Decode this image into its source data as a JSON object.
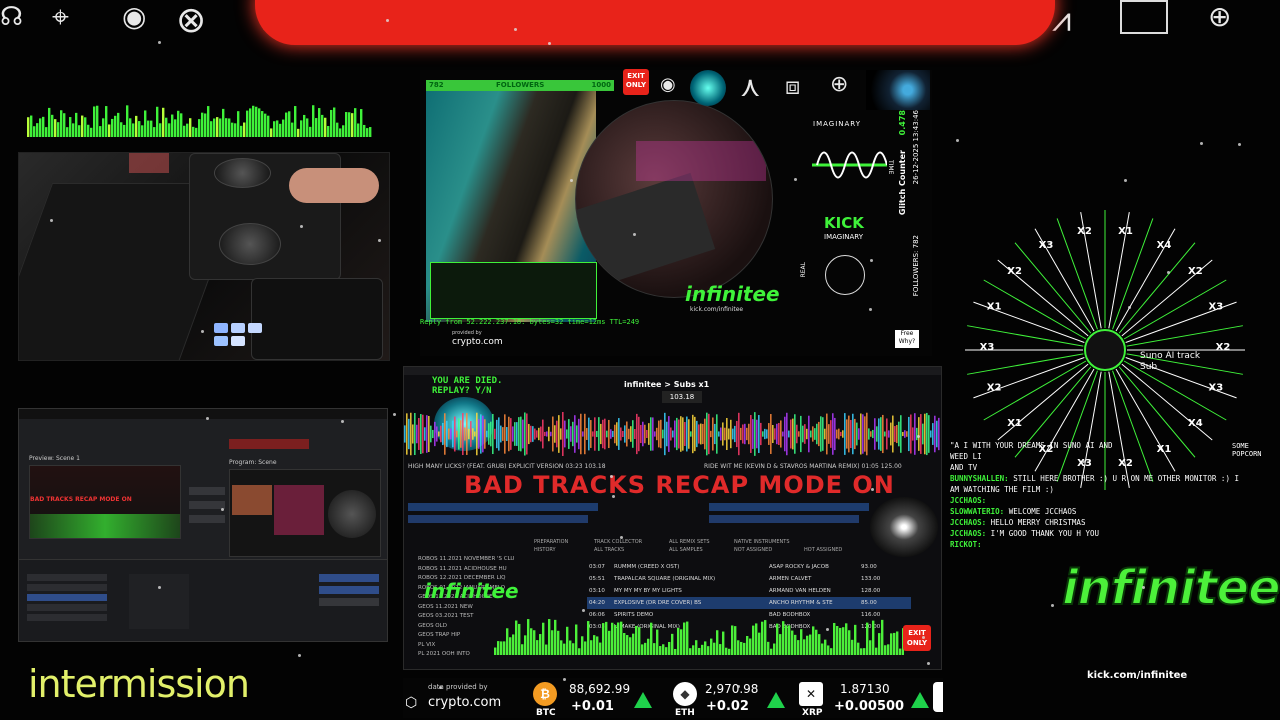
{
  "top_bar": {
    "glyphs": [
      "☊",
      "⌖",
      "◉",
      "⊗",
      "⋏",
      "⩘",
      "⊕"
    ]
  },
  "center_top": {
    "followers_label": "FOLLOWERS",
    "followers_left": "782",
    "followers_right": "1000",
    "exit_only": "EXIT ONLY",
    "imaginary": "IMAGINARY",
    "time": "TIME",
    "kick": "KICK",
    "kick_sub": "IMAGINARY",
    "real": "REAL",
    "glitch_counter": "Glitch Counter",
    "glitch_value": "0.478",
    "datetime": "26-12-2025 13:43:46",
    "followers_vertical": "FOLLOWERS: 782",
    "term_reply": "Reply from 52.222.237.18: bytes=32 time=12ms TTL=249",
    "provided_by": "provided by",
    "crypto_small": "crypto.com",
    "infinitee_small": "infinitee",
    "kick_url_small": "kick.com/infinitee",
    "free_why": "Free Why?"
  },
  "mixer": {
    "you_are_died": "YOU ARE DIED.",
    "replay": "REPLAY? Y/N",
    "app_title": "infinitee > Subs x1",
    "bpm": "103.18",
    "recap": "BAD TRACKS RECAP MODE ON",
    "tabs": [
      "PREPARATION",
      "HISTORY",
      "TRACK COLLECTOR",
      "ALL TRACKS",
      "ALL REMIX SETS",
      "ALL SAMPLES",
      "NATIVE INSTRUMENTS",
      "NOT ASSIGNED",
      "HOT ASSIGNED"
    ],
    "tracks": [
      {
        "time": "03:07",
        "title": "RUMMM (CREED X OST)",
        "artist": "ASAP ROCKY & JACOB",
        "bpm": "93.00"
      },
      {
        "time": "05:51",
        "title": "TRAPALCAR SQUARE (ORIGINAL MIX)",
        "artist": "ARMEN CALVET",
        "bpm": "133.00"
      },
      {
        "time": "03:10",
        "title": "MY MY MY BY MY LIGHTS",
        "artist": "ARMAND VAN HELDEN",
        "bpm": "128.00"
      },
      {
        "time": "04:20",
        "title": "EXPLOSIVE (DR DRE COVER) BS",
        "artist": "ANCHO RHYTHM & STE",
        "bpm": "85.00"
      },
      {
        "time": "06:06",
        "title": "SPIRITS DEMO",
        "artist": "BAD BODHBOX",
        "bpm": "116.00"
      },
      {
        "time": "03:03",
        "title": "U MAKE (ORIGINAL MIX)",
        "artist": "BAD BODHBOX",
        "bpm": "120.00"
      }
    ],
    "folders": [
      "ROBOS 11.2021 NOVEMBER 'S CLU",
      "ROBOS 11.2021 ACIDHOUSE HU",
      "ROBOS 12.2021 DECEMBER LIQ",
      "ROBOS 01.2022 JANUARY MELO",
      "GEOS 11.2021 ACIDHOUSE",
      "GEOS 11.2021 NEW",
      "GEOS 03.2021 TEST",
      "GEOS OLD",
      "GEOS TRAP HIP",
      "PL VIX",
      "PL 2021 OOH INTO"
    ],
    "exit_only": "EXIT ONLY",
    "deck_a_info": "HIGH MANY LICKS? (FEAT. GRUB) EXPLICIT VERSION 03:23 103.18",
    "deck_b_info": "RIDE WIT ME (KEVIN D & STAVROS MARTINA REMIX) 01:05 125.00"
  },
  "wheel": {
    "labels": [
      "X2",
      "X3",
      "X4",
      "X1",
      "X2",
      "X3",
      "X2",
      "X1",
      "X2",
      "X3",
      "X1",
      "X2",
      "X3",
      "X2",
      "X1",
      "X4",
      "X2",
      "X3"
    ],
    "center_text": [
      "Suno AI track",
      "Sub"
    ],
    "some_popcorn": "SOME POPCORN"
  },
  "chat": [
    {
      "user": "",
      "text": "\"A I          WITH YOUR DREAMS IN SUNO AI AND"
    },
    {
      "user": "",
      "text": "WEED LI"
    },
    {
      "user": "",
      "text": "AND TV"
    },
    {
      "user": "",
      "text": "   "
    },
    {
      "user": "BUNNYSHALLEN:",
      "text": "STILL HERE BROTHER :) U R ON ME OTHER MONITOR :) I"
    },
    {
      "user": "",
      "text": "AM WATCHING THE FILM :)"
    },
    {
      "user": "JCCHAOS:",
      "text": ""
    },
    {
      "user": "SLOWWATERIO:",
      "text": "WELCOME JCCHAOS"
    },
    {
      "user": "JCCHAOS:",
      "text": "HELLO MERRY CHRISTMAS"
    },
    {
      "user": "JCCHAOS:",
      "text": "I'M GOOD THANK YOU H         YOU"
    },
    {
      "user": "RICKOT:",
      "text": ""
    }
  ],
  "logo": {
    "name": "infinitee",
    "url": "kick.com/infinitee"
  },
  "intermission": "intermission",
  "ticker": {
    "provided_by": "data provided by",
    "brand": "crypto.com",
    "coins": [
      {
        "symbol": "BTC",
        "price": "88,692.99",
        "change": "+0.01"
      },
      {
        "symbol": "ETH",
        "price": "2,970.98",
        "change": "+0.02"
      },
      {
        "symbol": "XRP",
        "price": "1.87130",
        "change": "+0.00500"
      }
    ]
  },
  "obs": {
    "program_label": "Program: Scene",
    "preview_label": "Preview: Scene 1"
  },
  "colors": {
    "accent_green": "#3ff23a",
    "red": "#e8231a",
    "dark": "#030303"
  }
}
